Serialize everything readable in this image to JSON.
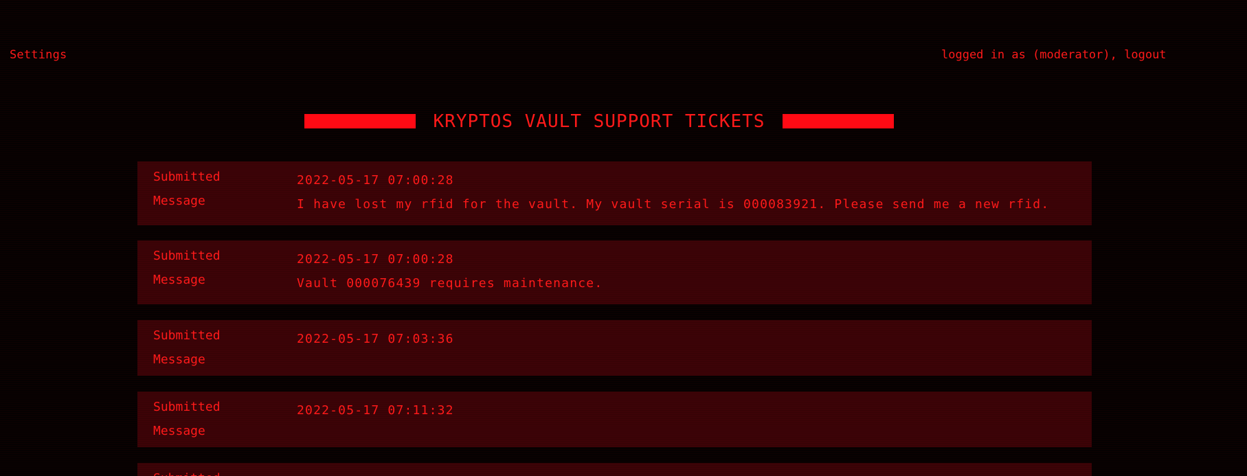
{
  "nav": {
    "settings_label": "Settings",
    "login_prefix": "logged in as (moderator),",
    "logout_label": "logout"
  },
  "title": "KRYPTOS VAULT SUPPORT TICKETS",
  "labels": {
    "submitted": "Submitted",
    "message": "Message"
  },
  "tickets": [
    {
      "submitted": "2022-05-17 07:00:28",
      "message": "I have lost my rfid for the vault. My vault serial is 000083921. Please send me a new rfid."
    },
    {
      "submitted": "2022-05-17 07:00:28",
      "message": "Vault 000076439 requires maintenance."
    },
    {
      "submitted": "2022-05-17 07:03:36",
      "message": ""
    },
    {
      "submitted": "2022-05-17 07:11:32",
      "message": ""
    },
    {
      "submitted": "",
      "message": ""
    }
  ],
  "colors": {
    "background": "#050101",
    "accent": "#ff1a1a",
    "ticket_bg": "#3d0307"
  }
}
